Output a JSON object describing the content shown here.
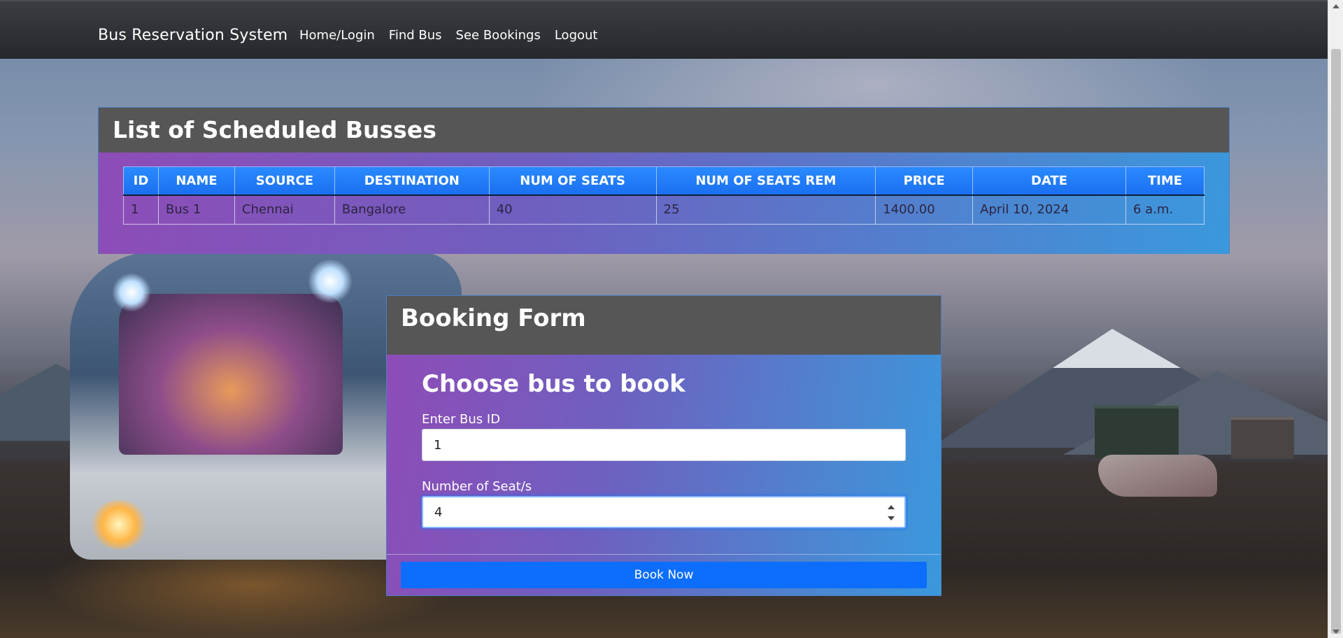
{
  "navbar": {
    "brand": "Bus Reservation System",
    "links": [
      "Home/Login",
      "Find Bus",
      "See Bookings",
      "Logout"
    ]
  },
  "busses_panel": {
    "title": "List of Scheduled Busses",
    "columns": [
      "ID",
      "NAME",
      "SOURCE",
      "DESTINATION",
      "NUM OF SEATS",
      "NUM OF SEATS REM",
      "PRICE",
      "DATE",
      "TIME"
    ],
    "rows": [
      [
        "1",
        "Bus 1",
        "Chennai",
        "Bangalore",
        "40",
        "25",
        "1400.00",
        "April 10, 2024",
        "6 a.m."
      ]
    ]
  },
  "booking_panel": {
    "title": "Booking Form",
    "form_title": "Choose bus to book",
    "bus_id_label": "Enter Bus ID",
    "bus_id_value": "1",
    "seats_label": "Number of Seat/s",
    "seats_value": "4",
    "submit_label": "Book Now"
  },
  "colors": {
    "navbar": "#25282c",
    "panel_header": "#565656",
    "gradient_start": "#8e4cb7",
    "gradient_end": "#3a98dd",
    "table_header": "#1a6ff0",
    "button": "#0d6efd"
  }
}
